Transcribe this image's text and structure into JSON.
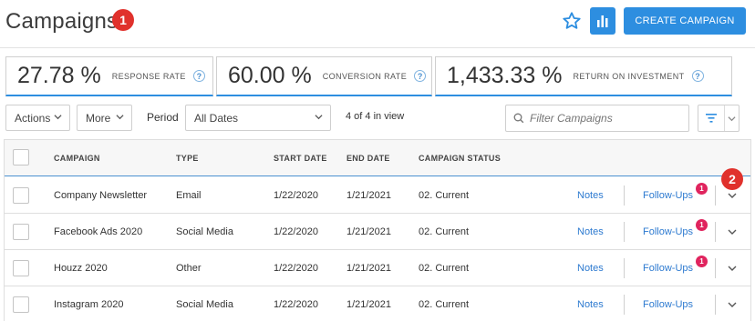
{
  "header": {
    "title": "Campaigns",
    "title_step": "1",
    "create_label": "CREATE CAMPAIGN",
    "star_icon": "star-icon",
    "chart_icon": "bar-chart-icon"
  },
  "stats": [
    {
      "value": "27.78 %",
      "label": "RESPONSE RATE",
      "help": "?"
    },
    {
      "value": "60.00 %",
      "label": "CONVERSION RATE",
      "help": "?"
    },
    {
      "value": "1,433.33 %",
      "label": "RETURN ON INVESTMENT",
      "help": "?"
    }
  ],
  "toolbar": {
    "actions_label": "Actions",
    "more_label": "More",
    "period_label": "Period",
    "period_value": "All Dates",
    "view_count": "4 of 4 in view",
    "search_placeholder": "Filter Campaigns"
  },
  "table": {
    "columns": [
      "CAMPAIGN",
      "TYPE",
      "START DATE",
      "END DATE",
      "CAMPAIGN STATUS"
    ],
    "step_badge": "2",
    "rows": [
      {
        "campaign": "Company Newsletter",
        "type": "Email",
        "start": "1/22/2020",
        "end": "1/21/2021",
        "status": "02. Current",
        "notes": "Notes",
        "followups": "Follow-Ups",
        "followup_count": "1"
      },
      {
        "campaign": "Facebook Ads 2020",
        "type": "Social Media",
        "start": "1/22/2020",
        "end": "1/21/2021",
        "status": "02. Current",
        "notes": "Notes",
        "followups": "Follow-Ups",
        "followup_count": "1"
      },
      {
        "campaign": "Houzz 2020",
        "type": "Other",
        "start": "1/22/2020",
        "end": "1/21/2021",
        "status": "02. Current",
        "notes": "Notes",
        "followups": "Follow-Ups",
        "followup_count": "1"
      },
      {
        "campaign": "Instagram 2020",
        "type": "Social Media",
        "start": "1/22/2020",
        "end": "1/21/2021",
        "status": "02. Current",
        "notes": "Notes",
        "followups": "Follow-Ups",
        "followup_count": ""
      }
    ]
  },
  "colors": {
    "accent": "#2d8ee0",
    "badge_red": "#e0312c",
    "count_badge": "#e0245e"
  }
}
